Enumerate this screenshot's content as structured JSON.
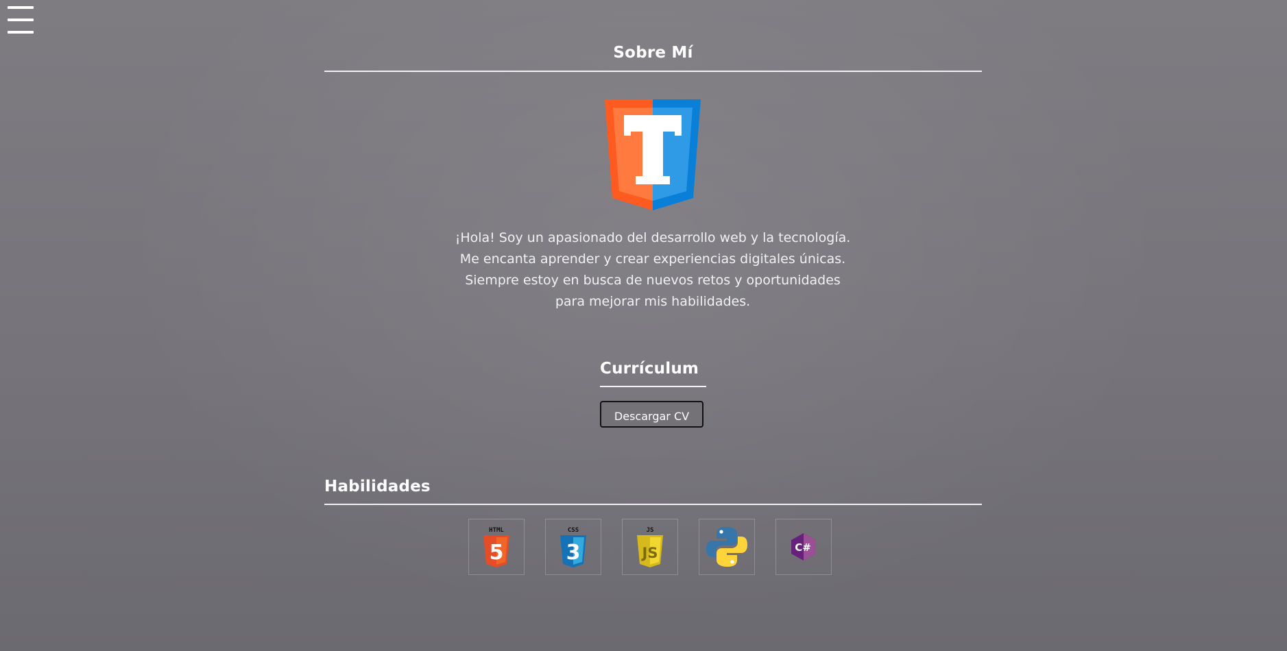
{
  "menu": {
    "icon": "hamburger-menu-icon"
  },
  "about": {
    "title": "Sobre Mí",
    "logo": {
      "icon": "t-shield-logo",
      "letter": "T",
      "colors": [
        "#ff5a1f",
        "#0a7fd8"
      ]
    },
    "intro_lines": [
      "¡Hola! Soy un apasionado del desarrollo web y la tecnología.",
      "Me encanta aprender y crear experiencias digitales únicas.",
      "Siempre estoy en busca de nuevos retos y oportunidades",
      "para mejorar mis habilidades."
    ]
  },
  "cv": {
    "title": "Currículum",
    "button_label": "Descargar CV"
  },
  "skills": {
    "title": "Habilidades",
    "items": [
      {
        "icon": "html5-icon",
        "label": "HTML",
        "glyph": "5",
        "color": "#e44d26"
      },
      {
        "icon": "css3-icon",
        "label": "CSS",
        "glyph": "3",
        "color": "#1572b6"
      },
      {
        "icon": "javascript-icon",
        "label": "JS",
        "glyph": "JS",
        "color": "#f7df1e"
      },
      {
        "icon": "python-icon",
        "label": "",
        "glyph": "",
        "color": "#3776ab"
      },
      {
        "icon": "csharp-icon",
        "label": "",
        "glyph": "C#",
        "color": "#68217a"
      }
    ]
  },
  "colors": {
    "background": "#7a787e",
    "text": "#ffffff",
    "button_border": "#111111"
  }
}
